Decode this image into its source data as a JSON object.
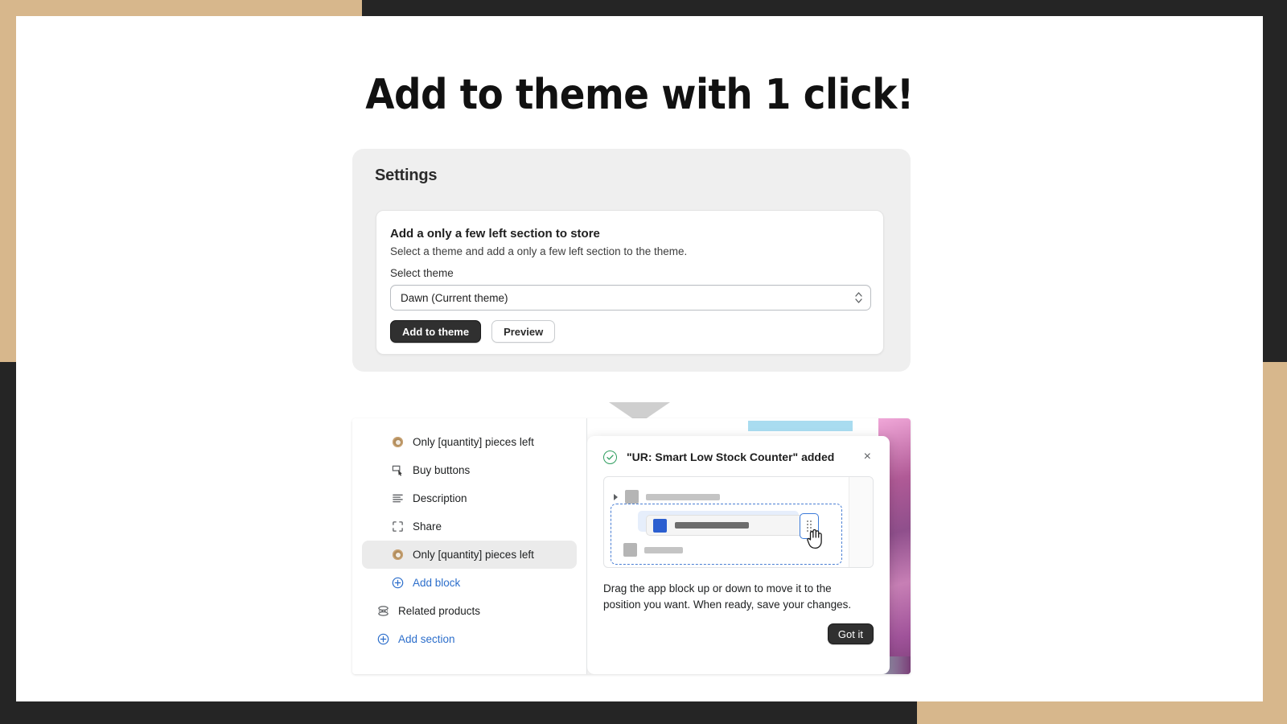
{
  "hero": {
    "title": "Add to theme with 1 click!"
  },
  "settings": {
    "title": "Settings",
    "card": {
      "heading": "Add a only a few left section to store",
      "subtext": "Select a theme and add a only a few left section to the theme.",
      "field_label": "Select theme",
      "select_value": "Dawn (Current theme)",
      "primary_button": "Add to theme",
      "secondary_button": "Preview"
    }
  },
  "editor": {
    "blocks": [
      {
        "label": "Only [quantity] pieces left",
        "icon": "app-block-icon",
        "selected": false,
        "link": false,
        "indent": "deep"
      },
      {
        "label": "Buy buttons",
        "icon": "buy-buttons-icon",
        "selected": false,
        "link": false,
        "indent": "deep"
      },
      {
        "label": "Description",
        "icon": "description-icon",
        "selected": false,
        "link": false,
        "indent": "deep"
      },
      {
        "label": "Share",
        "icon": "share-icon",
        "selected": false,
        "link": false,
        "indent": "deep"
      },
      {
        "label": "Only [quantity] pieces left",
        "icon": "app-block-icon",
        "selected": true,
        "link": false,
        "indent": "deep"
      },
      {
        "label": "Add block",
        "icon": "plus-circle-icon",
        "selected": false,
        "link": true,
        "indent": "deep"
      },
      {
        "label": "Related products",
        "icon": "related-products-icon",
        "selected": false,
        "link": false,
        "indent": "shallow"
      },
      {
        "label": "Add section",
        "icon": "plus-circle-icon",
        "selected": false,
        "link": true,
        "indent": "shallow"
      }
    ]
  },
  "tooltip": {
    "title": "\"UR: Smart Low Stock Counter\" added",
    "close_label": "×",
    "body": "Drag the app block up or down to move it to the position you want. When ready, save your changes.",
    "action_button": "Got it"
  },
  "colors": {
    "tan_band": "#d7b78c",
    "dark_band": "#252525",
    "accent_link": "#2c6ecb",
    "primary_button_bg": "#303030",
    "success_green": "#2f9e5f",
    "drag_blue": "#2c5fd0",
    "arrow_gray": "#cfcfcf"
  }
}
